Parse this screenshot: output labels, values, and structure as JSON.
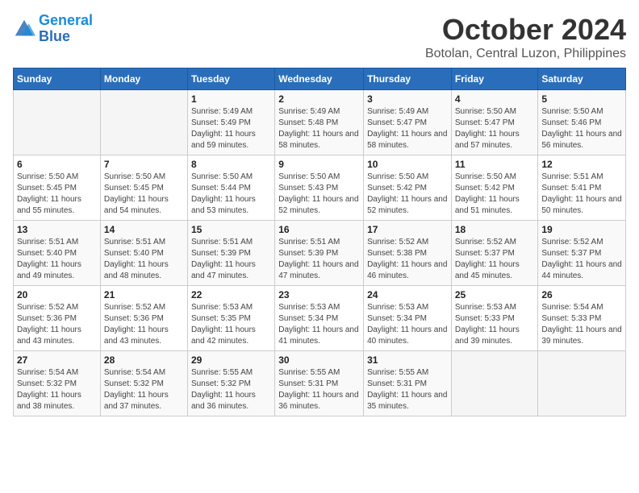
{
  "header": {
    "logo_line1": "General",
    "logo_line2": "Blue",
    "month_title": "October 2024",
    "subtitle": "Botolan, Central Luzon, Philippines"
  },
  "weekdays": [
    "Sunday",
    "Monday",
    "Tuesday",
    "Wednesday",
    "Thursday",
    "Friday",
    "Saturday"
  ],
  "weeks": [
    [
      {
        "day": "",
        "sunrise": "",
        "sunset": "",
        "daylight": ""
      },
      {
        "day": "",
        "sunrise": "",
        "sunset": "",
        "daylight": ""
      },
      {
        "day": "1",
        "sunrise": "Sunrise: 5:49 AM",
        "sunset": "Sunset: 5:49 PM",
        "daylight": "Daylight: 11 hours and 59 minutes."
      },
      {
        "day": "2",
        "sunrise": "Sunrise: 5:49 AM",
        "sunset": "Sunset: 5:48 PM",
        "daylight": "Daylight: 11 hours and 58 minutes."
      },
      {
        "day": "3",
        "sunrise": "Sunrise: 5:49 AM",
        "sunset": "Sunset: 5:47 PM",
        "daylight": "Daylight: 11 hours and 58 minutes."
      },
      {
        "day": "4",
        "sunrise": "Sunrise: 5:50 AM",
        "sunset": "Sunset: 5:47 PM",
        "daylight": "Daylight: 11 hours and 57 minutes."
      },
      {
        "day": "5",
        "sunrise": "Sunrise: 5:50 AM",
        "sunset": "Sunset: 5:46 PM",
        "daylight": "Daylight: 11 hours and 56 minutes."
      }
    ],
    [
      {
        "day": "6",
        "sunrise": "Sunrise: 5:50 AM",
        "sunset": "Sunset: 5:45 PM",
        "daylight": "Daylight: 11 hours and 55 minutes."
      },
      {
        "day": "7",
        "sunrise": "Sunrise: 5:50 AM",
        "sunset": "Sunset: 5:45 PM",
        "daylight": "Daylight: 11 hours and 54 minutes."
      },
      {
        "day": "8",
        "sunrise": "Sunrise: 5:50 AM",
        "sunset": "Sunset: 5:44 PM",
        "daylight": "Daylight: 11 hours and 53 minutes."
      },
      {
        "day": "9",
        "sunrise": "Sunrise: 5:50 AM",
        "sunset": "Sunset: 5:43 PM",
        "daylight": "Daylight: 11 hours and 52 minutes."
      },
      {
        "day": "10",
        "sunrise": "Sunrise: 5:50 AM",
        "sunset": "Sunset: 5:42 PM",
        "daylight": "Daylight: 11 hours and 52 minutes."
      },
      {
        "day": "11",
        "sunrise": "Sunrise: 5:50 AM",
        "sunset": "Sunset: 5:42 PM",
        "daylight": "Daylight: 11 hours and 51 minutes."
      },
      {
        "day": "12",
        "sunrise": "Sunrise: 5:51 AM",
        "sunset": "Sunset: 5:41 PM",
        "daylight": "Daylight: 11 hours and 50 minutes."
      }
    ],
    [
      {
        "day": "13",
        "sunrise": "Sunrise: 5:51 AM",
        "sunset": "Sunset: 5:40 PM",
        "daylight": "Daylight: 11 hours and 49 minutes."
      },
      {
        "day": "14",
        "sunrise": "Sunrise: 5:51 AM",
        "sunset": "Sunset: 5:40 PM",
        "daylight": "Daylight: 11 hours and 48 minutes."
      },
      {
        "day": "15",
        "sunrise": "Sunrise: 5:51 AM",
        "sunset": "Sunset: 5:39 PM",
        "daylight": "Daylight: 11 hours and 47 minutes."
      },
      {
        "day": "16",
        "sunrise": "Sunrise: 5:51 AM",
        "sunset": "Sunset: 5:39 PM",
        "daylight": "Daylight: 11 hours and 47 minutes."
      },
      {
        "day": "17",
        "sunrise": "Sunrise: 5:52 AM",
        "sunset": "Sunset: 5:38 PM",
        "daylight": "Daylight: 11 hours and 46 minutes."
      },
      {
        "day": "18",
        "sunrise": "Sunrise: 5:52 AM",
        "sunset": "Sunset: 5:37 PM",
        "daylight": "Daylight: 11 hours and 45 minutes."
      },
      {
        "day": "19",
        "sunrise": "Sunrise: 5:52 AM",
        "sunset": "Sunset: 5:37 PM",
        "daylight": "Daylight: 11 hours and 44 minutes."
      }
    ],
    [
      {
        "day": "20",
        "sunrise": "Sunrise: 5:52 AM",
        "sunset": "Sunset: 5:36 PM",
        "daylight": "Daylight: 11 hours and 43 minutes."
      },
      {
        "day": "21",
        "sunrise": "Sunrise: 5:52 AM",
        "sunset": "Sunset: 5:36 PM",
        "daylight": "Daylight: 11 hours and 43 minutes."
      },
      {
        "day": "22",
        "sunrise": "Sunrise: 5:53 AM",
        "sunset": "Sunset: 5:35 PM",
        "daylight": "Daylight: 11 hours and 42 minutes."
      },
      {
        "day": "23",
        "sunrise": "Sunrise: 5:53 AM",
        "sunset": "Sunset: 5:34 PM",
        "daylight": "Daylight: 11 hours and 41 minutes."
      },
      {
        "day": "24",
        "sunrise": "Sunrise: 5:53 AM",
        "sunset": "Sunset: 5:34 PM",
        "daylight": "Daylight: 11 hours and 40 minutes."
      },
      {
        "day": "25",
        "sunrise": "Sunrise: 5:53 AM",
        "sunset": "Sunset: 5:33 PM",
        "daylight": "Daylight: 11 hours and 39 minutes."
      },
      {
        "day": "26",
        "sunrise": "Sunrise: 5:54 AM",
        "sunset": "Sunset: 5:33 PM",
        "daylight": "Daylight: 11 hours and 39 minutes."
      }
    ],
    [
      {
        "day": "27",
        "sunrise": "Sunrise: 5:54 AM",
        "sunset": "Sunset: 5:32 PM",
        "daylight": "Daylight: 11 hours and 38 minutes."
      },
      {
        "day": "28",
        "sunrise": "Sunrise: 5:54 AM",
        "sunset": "Sunset: 5:32 PM",
        "daylight": "Daylight: 11 hours and 37 minutes."
      },
      {
        "day": "29",
        "sunrise": "Sunrise: 5:55 AM",
        "sunset": "Sunset: 5:32 PM",
        "daylight": "Daylight: 11 hours and 36 minutes."
      },
      {
        "day": "30",
        "sunrise": "Sunrise: 5:55 AM",
        "sunset": "Sunset: 5:31 PM",
        "daylight": "Daylight: 11 hours and 36 minutes."
      },
      {
        "day": "31",
        "sunrise": "Sunrise: 5:55 AM",
        "sunset": "Sunset: 5:31 PM",
        "daylight": "Daylight: 11 hours and 35 minutes."
      },
      {
        "day": "",
        "sunrise": "",
        "sunset": "",
        "daylight": ""
      },
      {
        "day": "",
        "sunrise": "",
        "sunset": "",
        "daylight": ""
      }
    ]
  ]
}
